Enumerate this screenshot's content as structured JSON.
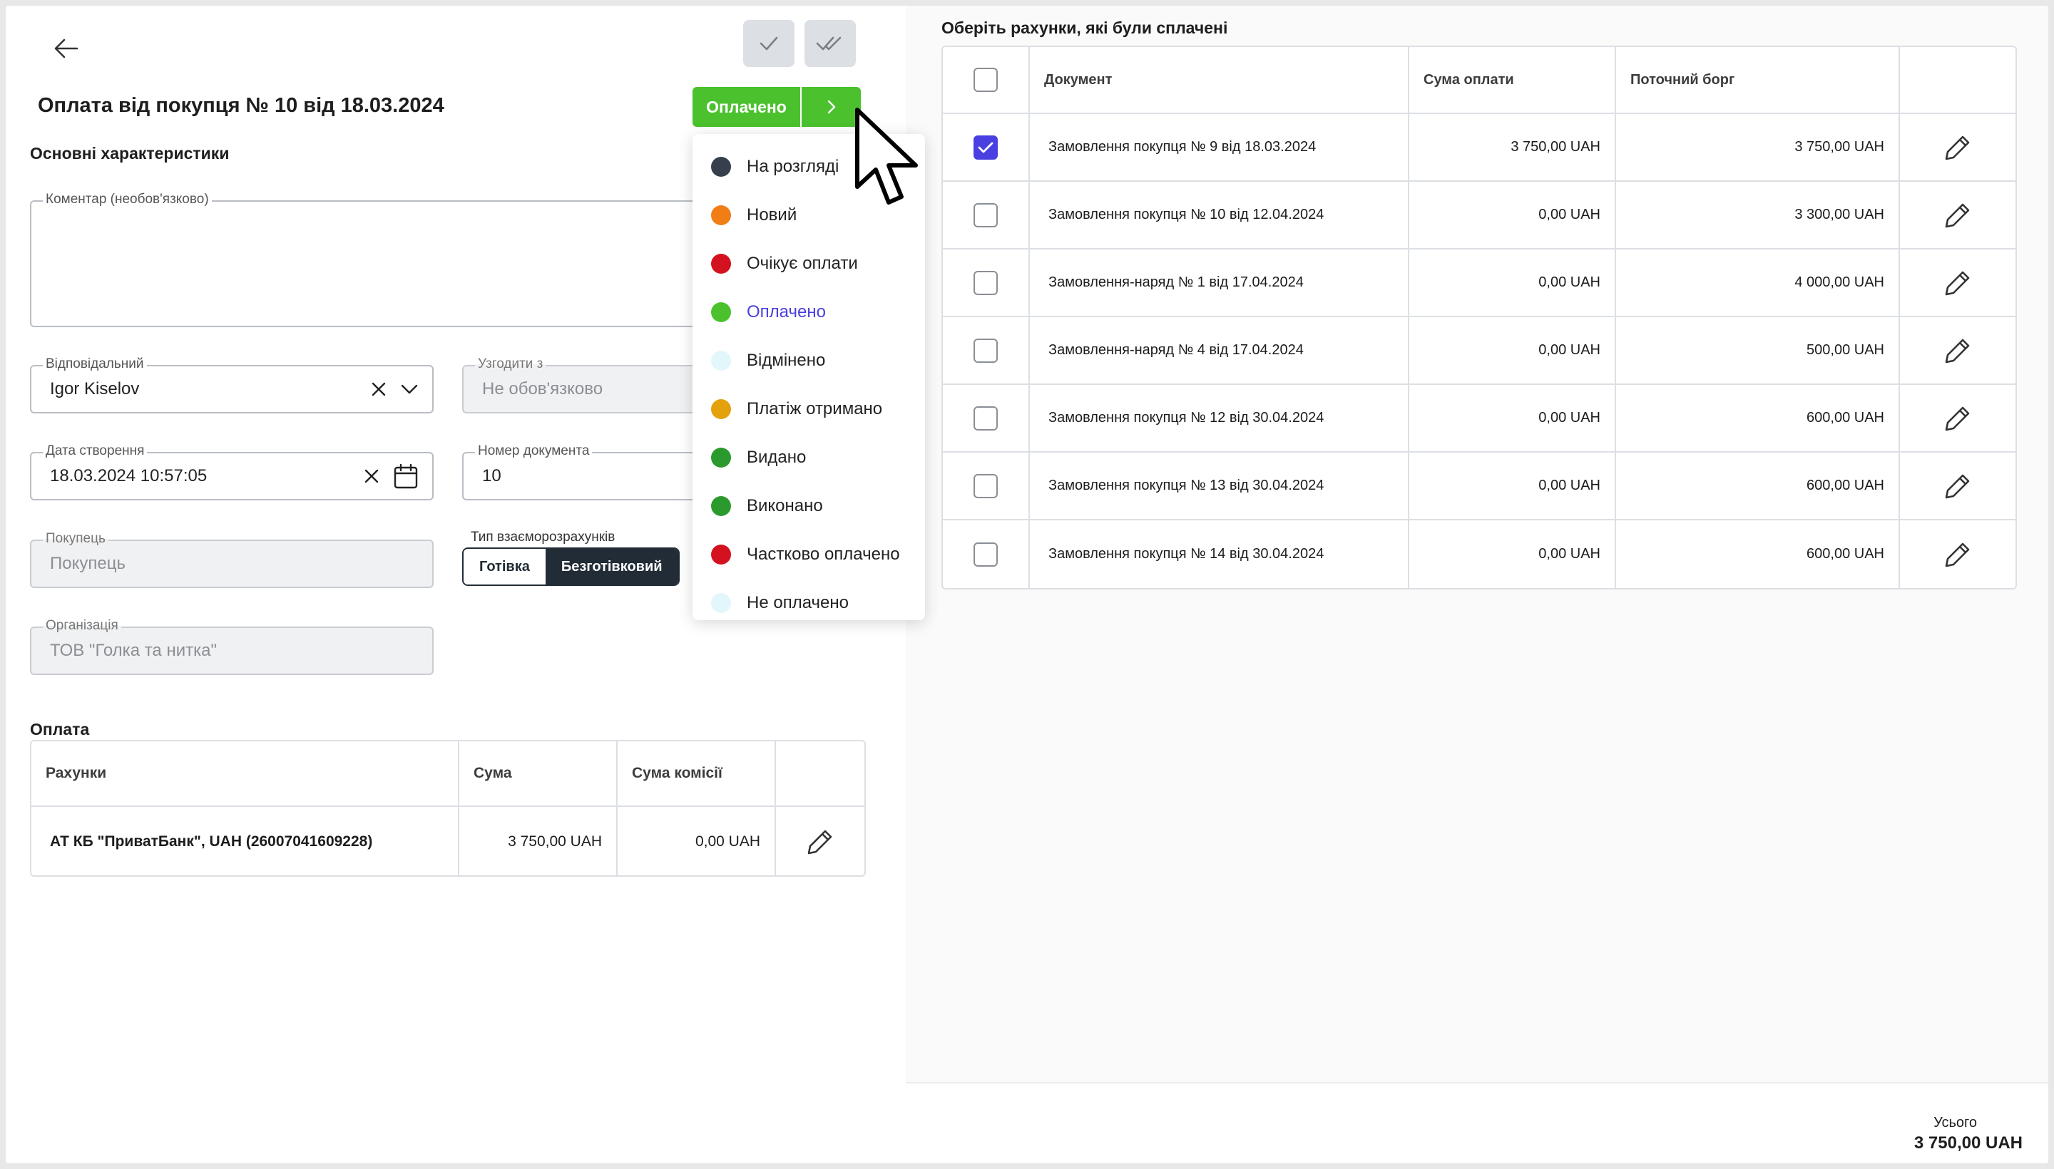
{
  "header": {
    "title": "Оплата від покупця № 10 від 18.03.2024",
    "status_label": "Оплачено"
  },
  "sections": {
    "main": "Основні характеристики",
    "payment": "Оплата"
  },
  "fields": {
    "comment_label": "Коментар (необов'язково)",
    "responsible_label": "Відповідальний",
    "responsible_value": "Igor Kiselov",
    "approve_label": "Узгодити з",
    "approve_placeholder": "Не обов'язково",
    "created_label": "Дата створення",
    "created_value": "18.03.2024 10:57:05",
    "docnum_label": "Номер документа",
    "docnum_value": "10",
    "buyer_label": "Покупець",
    "buyer_placeholder": "Покупець",
    "settlement_label": "Тип взаєморозрахунків",
    "settlement_options": [
      "Готівка",
      "Безготівковий"
    ],
    "settlement_selected": "Безготівковий",
    "org_label": "Організація",
    "org_value": "ТОВ \"Голка та нитка\""
  },
  "payment_table": {
    "headers": [
      "Рахунки",
      "Сума",
      "Сума комісії"
    ],
    "rows": [
      {
        "account": "АТ КБ \"ПриватБанк\", UAH (26007041609228)",
        "sum": "3 750,00 UAH",
        "fee": "0,00 UAH"
      }
    ]
  },
  "status_dropdown": {
    "selected": "Оплачено",
    "items": [
      {
        "label": "На розгляді",
        "color": "#363f4b"
      },
      {
        "label": "Новий",
        "color": "#f07e15"
      },
      {
        "label": "Очікує оплати",
        "color": "#d4111e"
      },
      {
        "label": "Оплачено",
        "color": "#4bc12e"
      },
      {
        "label": "Відмінено",
        "color": "#e2f7fb"
      },
      {
        "label": "Платіж отримано",
        "color": "#e3a20b"
      },
      {
        "label": "Видано",
        "color": "#2b9a2e"
      },
      {
        "label": "Виконано",
        "color": "#2b9a2e"
      },
      {
        "label": "Частково оплачено",
        "color": "#d4111e"
      },
      {
        "label": "Не оплачено",
        "color": "#e2f7fb"
      }
    ]
  },
  "invoices": {
    "title": "Оберіть рахунки, які були сплачені",
    "headers": [
      "Документ",
      "Сума оплати",
      "Поточний борг"
    ],
    "rows": [
      {
        "checked": true,
        "doc": "Замовлення покупця № 9 від 18.03.2024",
        "paid": "3 750,00 UAH",
        "debt": "3 750,00 UAH"
      },
      {
        "checked": false,
        "doc": "Замовлення покупця № 10 від 12.04.2024",
        "paid": "0,00 UAH",
        "debt": "3 300,00 UAH"
      },
      {
        "checked": false,
        "doc": "Замовлення-наряд № 1 від 17.04.2024",
        "paid": "0,00 UAH",
        "debt": "4 000,00 UAH"
      },
      {
        "checked": false,
        "doc": "Замовлення-наряд № 4 від 17.04.2024",
        "paid": "0,00 UAH",
        "debt": "500,00 UAH"
      },
      {
        "checked": false,
        "doc": "Замовлення покупця № 12 від 30.04.2024",
        "paid": "0,00 UAH",
        "debt": "600,00 UAH"
      },
      {
        "checked": false,
        "doc": "Замовлення покупця № 13 від 30.04.2024",
        "paid": "0,00 UAH",
        "debt": "600,00 UAH"
      },
      {
        "checked": false,
        "doc": "Замовлення покупця № 14 від 30.04.2024",
        "paid": "0,00 UAH",
        "debt": "600,00 UAH"
      }
    ]
  },
  "footer": {
    "total_label": "Усього",
    "total_value": "3 750,00 UAH"
  },
  "colors": {
    "status_green": "#4bc12e",
    "accent_purple": "#4a3fe0",
    "toggle_dark": "#222c36"
  },
  "icons": [
    "arrow-left-icon",
    "check-icon",
    "double-check-icon",
    "chevron-right-icon",
    "close-icon",
    "chevron-down-icon",
    "calendar-icon",
    "pencil-icon",
    "checkbox-check-icon",
    "mouse-cursor-icon"
  ]
}
